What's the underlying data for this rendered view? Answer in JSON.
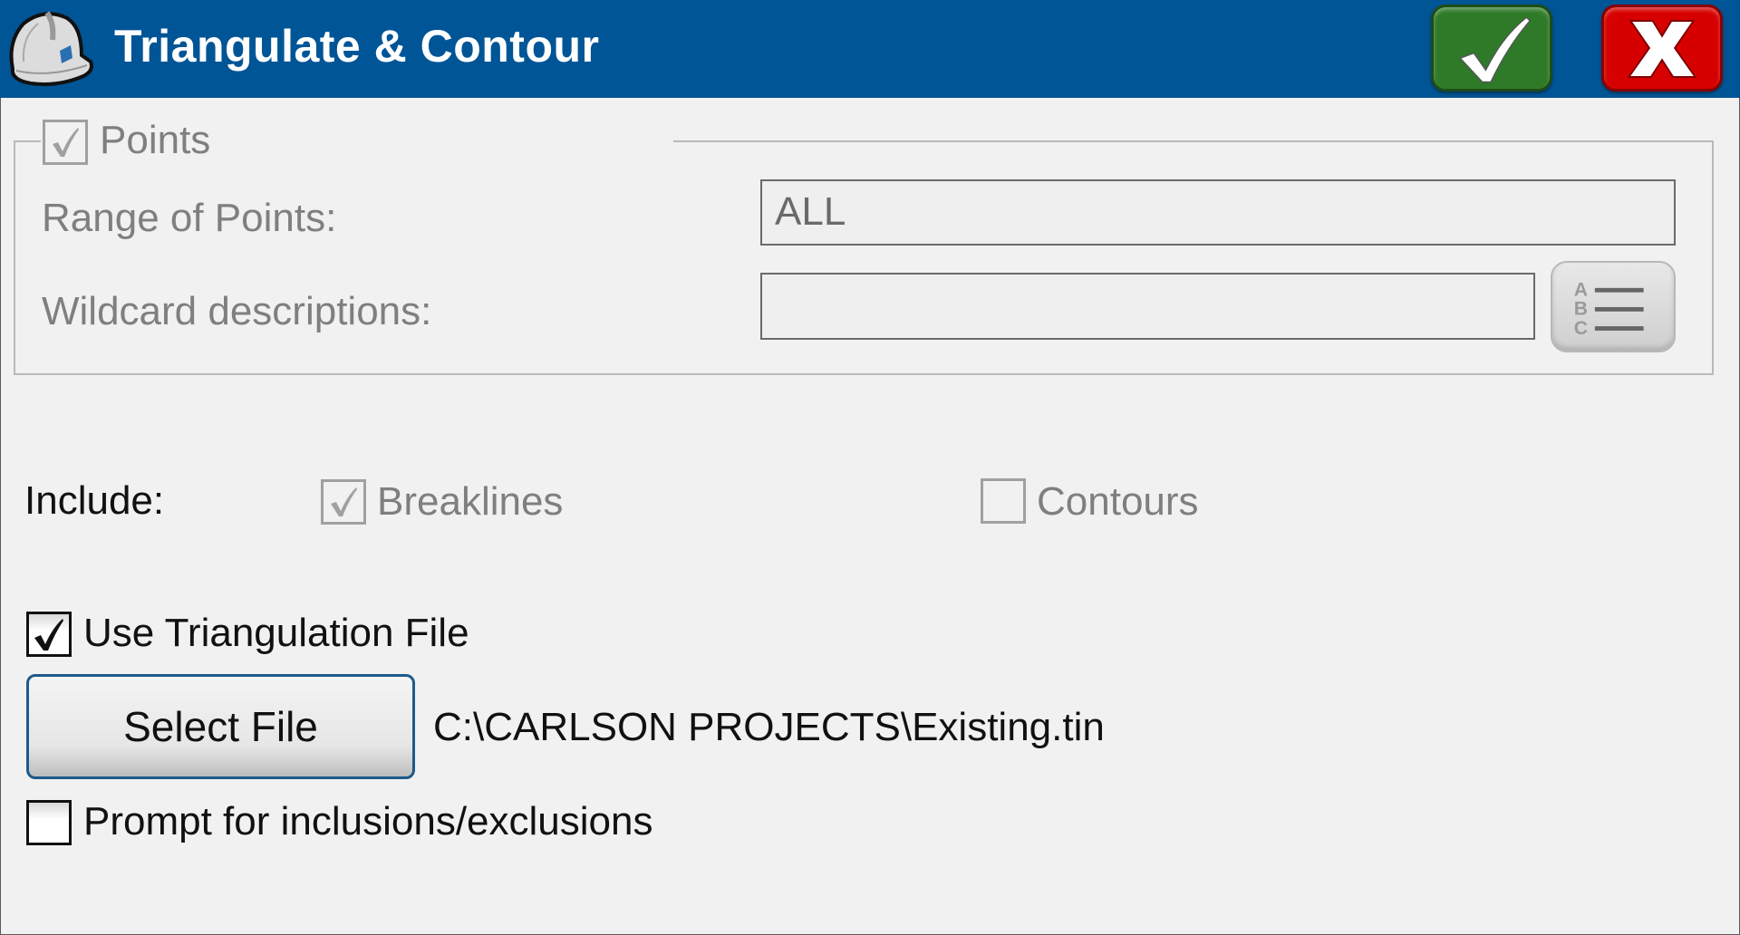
{
  "window": {
    "title": "Triangulate & Contour",
    "icons": {
      "app": "hardhat-icon",
      "ok": "checkmark-icon",
      "cancel": "x-icon"
    },
    "colors": {
      "titlebar": "#005596",
      "ok": "#2f7a28",
      "cancel": "#d60000"
    }
  },
  "points_group": {
    "label": "Points",
    "checked": true,
    "enabled": false,
    "range_label": "Range of Points:",
    "range_value": "ALL",
    "wildcard_label": "Wildcard descriptions:",
    "wildcard_value": "",
    "list_button_icon": "abc-list-icon"
  },
  "include": {
    "label": "Include:",
    "breaklines": {
      "label": "Breaklines",
      "checked": true,
      "enabled": false
    },
    "contours": {
      "label": "Contours",
      "checked": false,
      "enabled": false
    }
  },
  "triangulation": {
    "use_file_label": "Use Triangulation File",
    "use_file_checked": true,
    "select_button_label": "Select File",
    "file_path": "C:\\CARLSON PROJECTS\\Existing.tin"
  },
  "prompt": {
    "label": "Prompt for inclusions/exclusions",
    "checked": false
  }
}
